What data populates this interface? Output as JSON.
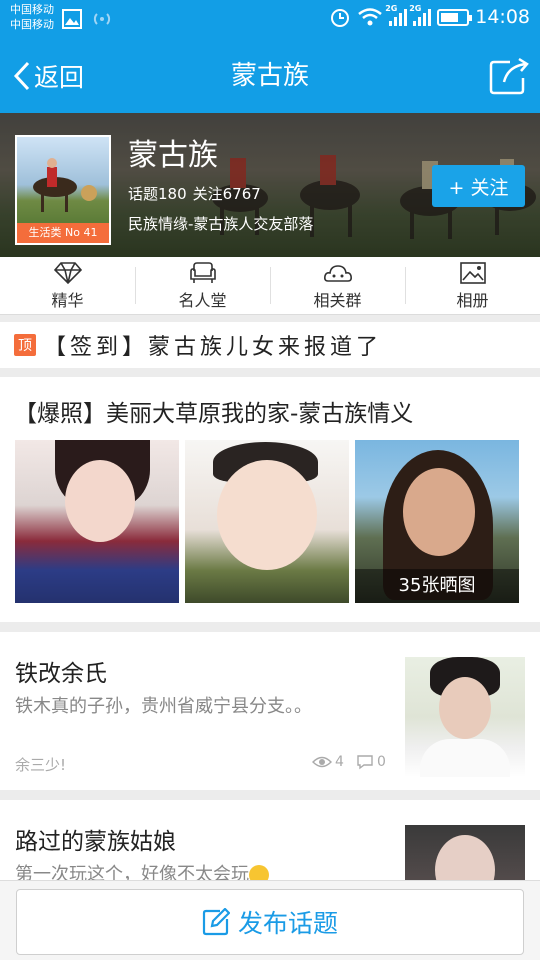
{
  "status_bar": {
    "carrier_1": "中国移动",
    "carrier_2": "中国移动",
    "network_1": "2G",
    "network_2": "2G",
    "battery_level": 0.7,
    "time": "14:08"
  },
  "nav": {
    "back_label": "返回",
    "title": "蒙古族"
  },
  "tribe": {
    "name": "蒙古族",
    "category_badge": "生活类 No 41",
    "topics": "话题180",
    "followers": "关注6767",
    "description": "民族情缘-蒙古族人交友部落",
    "follow_label": "+ 关注"
  },
  "tabs": [
    {
      "label": "精华",
      "icon": "diamond-icon"
    },
    {
      "label": "名人堂",
      "icon": "sofa-icon"
    },
    {
      "label": "相关群",
      "icon": "group-icon"
    },
    {
      "label": "相册",
      "icon": "picture-icon"
    }
  ],
  "pinned": {
    "tag": "顶",
    "text": "【签到】蒙古族儿女来报道了"
  },
  "photo_post": {
    "title": "【爆照】美丽大草原我的家-蒙古族情义",
    "photo_count": "35张晒图"
  },
  "posts": [
    {
      "title": "铁改余氏",
      "excerpt": "铁木真的子孙，贵州省威宁县分支。。",
      "author": "余三少!",
      "views": "4",
      "replies": "0"
    },
    {
      "title": "路过的蒙族姑娘",
      "excerpt": "第一次玩这个，好像不太会玩"
    }
  ],
  "publish": {
    "label": "发布话题"
  },
  "colors": {
    "brand_blue": "#129ee6",
    "accent_orange": "#f46d3b"
  }
}
